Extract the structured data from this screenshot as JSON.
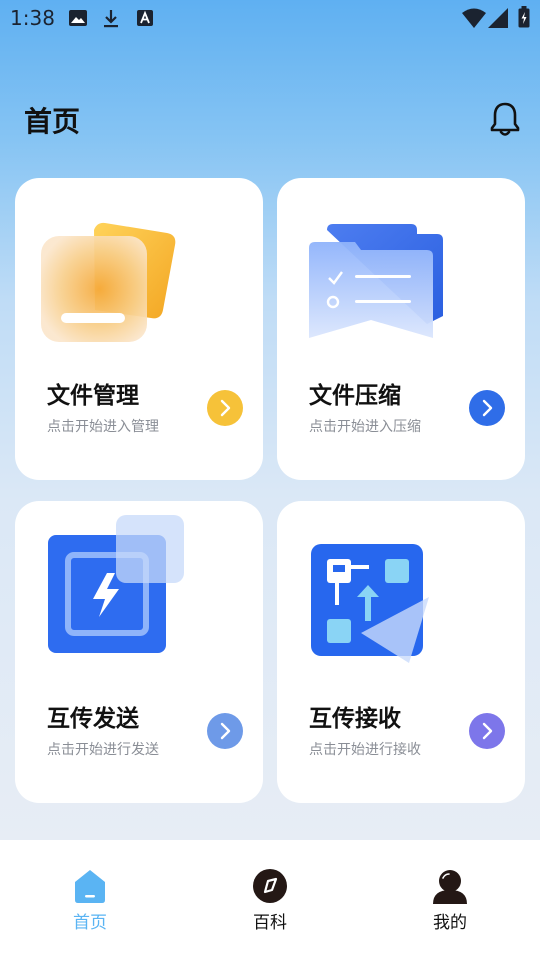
{
  "status_bar": {
    "time": "1:38",
    "left_icons": [
      "image-icon",
      "download-icon",
      "font-a-icon"
    ],
    "right_icons": [
      "wifi-icon",
      "signal-icon",
      "battery-icon"
    ]
  },
  "header": {
    "title": "首页",
    "bell_icon": "bell-icon"
  },
  "cards": [
    {
      "title": "文件管理",
      "subtitle": "点击开始进入管理",
      "icon": "folder-icon",
      "arrow_color": "#f6c239"
    },
    {
      "title": "文件压缩",
      "subtitle": "点击开始进入压缩",
      "icon": "document-stack-icon",
      "arrow_color": "#2f6de8"
    },
    {
      "title": "互传发送",
      "subtitle": "点击开始进行发送",
      "icon": "lightning-send-icon",
      "arrow_color": "#6e9ae8"
    },
    {
      "title": "互传接收",
      "subtitle": "点击开始进行接收",
      "icon": "grid-upload-icon",
      "arrow_color": "#7d76ea"
    }
  ],
  "bottom_nav": {
    "items": [
      {
        "label": "首页",
        "icon": "home-icon",
        "active": true
      },
      {
        "label": "百科",
        "icon": "compass-icon",
        "active": false
      },
      {
        "label": "我的",
        "icon": "user-icon",
        "active": false
      }
    ],
    "active_color": "#5ab4f3"
  }
}
